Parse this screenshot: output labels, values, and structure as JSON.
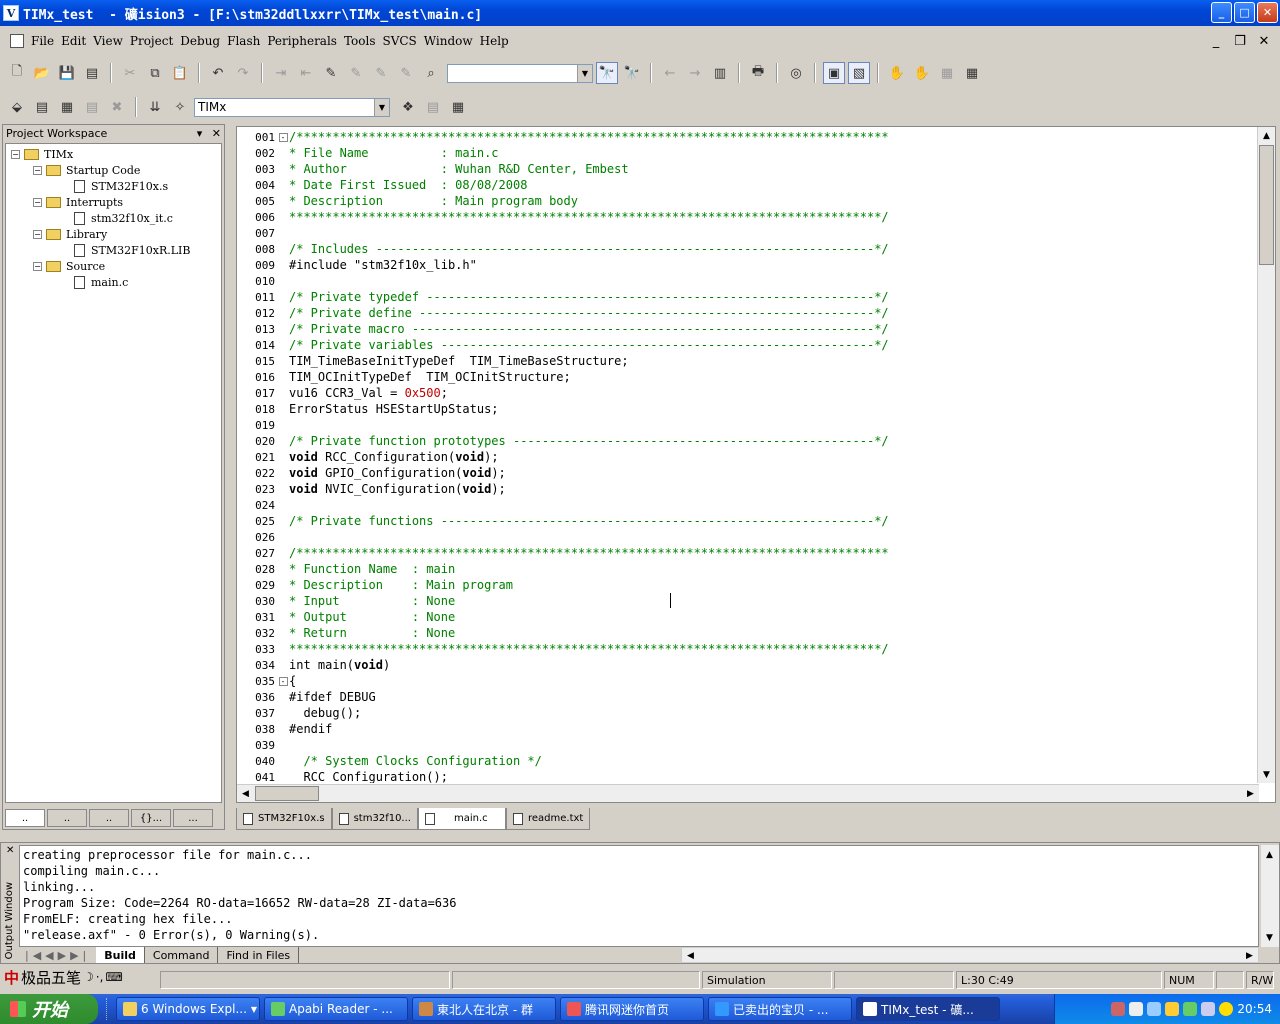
{
  "title_bar": {
    "app_icon": "uvision-icon",
    "title": "TIMx_test  - 礦ision3 - [F:\\stm32ddllxxrr\\TIMx_test\\main.c]",
    "minimize": "_",
    "maximize": "□",
    "close": "✕"
  },
  "menu": {
    "items": [
      "File",
      "Edit",
      "View",
      "Project",
      "Debug",
      "Flash",
      "Peripherals",
      "Tools",
      "SVCS",
      "Window",
      "Help"
    ],
    "mdi_min": "_",
    "mdi_restore": "❐",
    "mdi_close": "✕"
  },
  "toolbar": {
    "find_value": "",
    "target": "TIMx"
  },
  "workspace": {
    "title": "Project Workspace",
    "pin": "▾",
    "close": "✕",
    "tree": [
      {
        "label": "TIMx",
        "type": "root"
      },
      {
        "label": "Startup Code",
        "type": "group"
      },
      {
        "label": "STM32F10x.s",
        "type": "file"
      },
      {
        "label": "Interrupts",
        "type": "group"
      },
      {
        "label": "stm32f10x_it.c",
        "type": "file"
      },
      {
        "label": "Library",
        "type": "group"
      },
      {
        "label": "STM32F10xR.LIB",
        "type": "file"
      },
      {
        "label": "Source",
        "type": "group"
      },
      {
        "label": "main.c",
        "type": "file"
      }
    ],
    "tabs": [
      "..",
      "..",
      "..",
      "{}...",
      "..."
    ]
  },
  "editor": {
    "lines": [
      {
        "n": "001",
        "c": "/**********************************************************************************",
        "t": "cm",
        "fold": "-"
      },
      {
        "n": "002",
        "c": "* File Name          : main.c",
        "t": "cm"
      },
      {
        "n": "003",
        "c": "* Author             : Wuhan R&D Center, Embest",
        "t": "cm"
      },
      {
        "n": "004",
        "c": "* Date First Issued  : 08/08/2008",
        "t": "cm"
      },
      {
        "n": "005",
        "c": "* Description        : Main program body",
        "t": "cm"
      },
      {
        "n": "006",
        "c": "**********************************************************************************/",
        "t": "cm"
      },
      {
        "n": "007",
        "c": "",
        "t": ""
      },
      {
        "n": "008",
        "c": "/* Includes ---------------------------------------------------------------------*/",
        "t": "cm"
      },
      {
        "n": "009",
        "c": "#include \"stm32f10x_lib.h\"",
        "t": ""
      },
      {
        "n": "010",
        "c": "",
        "t": ""
      },
      {
        "n": "011",
        "c": "/* Private typedef --------------------------------------------------------------*/",
        "t": "cm"
      },
      {
        "n": "012",
        "c": "/* Private define ---------------------------------------------------------------*/",
        "t": "cm"
      },
      {
        "n": "013",
        "c": "/* Private macro ----------------------------------------------------------------*/",
        "t": "cm"
      },
      {
        "n": "014",
        "c": "/* Private variables ------------------------------------------------------------*/",
        "t": "cm"
      },
      {
        "n": "015",
        "c": "TIM_TimeBaseInitTypeDef  TIM_TimeBaseStructure;",
        "t": ""
      },
      {
        "n": "016",
        "c": "TIM_OCInitTypeDef  TIM_OCInitStructure;",
        "t": ""
      },
      {
        "n": "017",
        "c": "vu16 CCR3_Val = 0x500;",
        "t": "num"
      },
      {
        "n": "018",
        "c": "ErrorStatus HSEStartUpStatus;",
        "t": ""
      },
      {
        "n": "019",
        "c": "",
        "t": ""
      },
      {
        "n": "020",
        "c": "/* Private function prototypes --------------------------------------------------*/",
        "t": "cm"
      },
      {
        "n": "021",
        "c": "void RCC_Configuration(void);",
        "t": "kw"
      },
      {
        "n": "022",
        "c": "void GPIO_Configuration(void);",
        "t": "kw"
      },
      {
        "n": "023",
        "c": "void NVIC_Configuration(void);",
        "t": "kw"
      },
      {
        "n": "024",
        "c": "",
        "t": ""
      },
      {
        "n": "025",
        "c": "/* Private functions ------------------------------------------------------------*/",
        "t": "cm"
      },
      {
        "n": "026",
        "c": "",
        "t": ""
      },
      {
        "n": "027",
        "c": "/**********************************************************************************",
        "t": "cm"
      },
      {
        "n": "028",
        "c": "* Function Name  : main",
        "t": "cm"
      },
      {
        "n": "029",
        "c": "* Description    : Main program",
        "t": "cm"
      },
      {
        "n": "030",
        "c": "* Input          : None",
        "t": "cm"
      },
      {
        "n": "031",
        "c": "* Output         : None",
        "t": "cm"
      },
      {
        "n": "032",
        "c": "* Return         : None",
        "t": "cm"
      },
      {
        "n": "033",
        "c": "**********************************************************************************/",
        "t": "cm"
      },
      {
        "n": "034",
        "c": "int main(void)",
        "t": "kw2"
      },
      {
        "n": "035",
        "c": "{",
        "t": "",
        "fold": "-"
      },
      {
        "n": "036",
        "c": "#ifdef DEBUG",
        "t": ""
      },
      {
        "n": "037",
        "c": "  debug();",
        "t": ""
      },
      {
        "n": "038",
        "c": "#endif",
        "t": ""
      },
      {
        "n": "039",
        "c": "",
        "t": ""
      },
      {
        "n": "040",
        "c": "  /* System Clocks Configuration */",
        "t": "cm"
      },
      {
        "n": "041",
        "c": "  RCC_Configuration();",
        "t": ""
      }
    ],
    "tabs": [
      "STM32F10x.s",
      "stm32f10...",
      "main.c",
      "readme.txt"
    ],
    "active_tab": "main.c"
  },
  "output": {
    "close": "✕",
    "window_label": "Output Window",
    "lines": [
      "creating preprocessor file for main.c...",
      "compiling main.c...",
      "linking...",
      "Program Size: Code=2264 RO-data=16652 RW-data=28 ZI-data=636",
      "FromELF: creating hex file...",
      "\"release.axf\" - 0 Error(s), 0 Warning(s)."
    ],
    "tabs": [
      "Build",
      "Command",
      "Find in Files"
    ]
  },
  "ime": {
    "name": "极品五笔"
  },
  "status": {
    "mode": "Simulation",
    "position": "L:30 C:49",
    "num": "NUM",
    "rw": "R/W"
  },
  "taskbar": {
    "start": "开始",
    "tasks": [
      {
        "label": "6 Windows Expl...",
        "active": false
      },
      {
        "label": "Apabi Reader - ...",
        "active": false
      },
      {
        "label": "東北人在北京 - 群",
        "active": false
      },
      {
        "label": "腾讯网迷你首页",
        "active": false
      },
      {
        "label": "已卖出的宝贝 - ...",
        "active": false
      },
      {
        "label": "TIMx_test  - 礦...",
        "active": true
      }
    ],
    "clock": "20:54"
  }
}
